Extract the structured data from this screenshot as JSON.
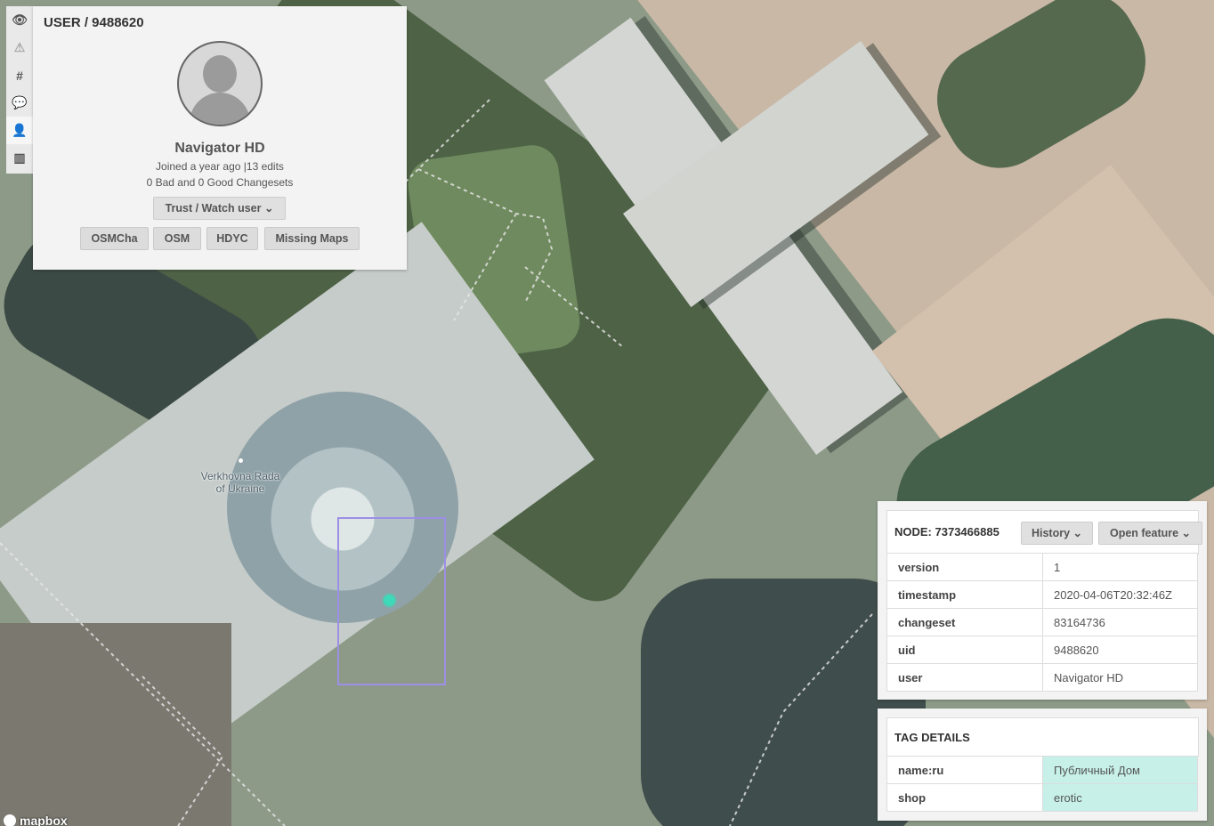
{
  "map": {
    "place_label_line1": "Verkhovna Rada",
    "place_label_line2": "of Ukraine",
    "attribution": "mapbox"
  },
  "rail": {
    "icons": [
      "eye-icon",
      "warning-icon",
      "hash-icon",
      "comment-icon",
      "user-icon",
      "map-icon"
    ],
    "glyphs": [
      "👁",
      "⚠",
      "#",
      "💬",
      "👤",
      "▥"
    ],
    "active": "user-icon"
  },
  "user_panel": {
    "title": "USER / 9488620",
    "name": "Navigator HD",
    "joined": "Joined a year ago  |13 edits",
    "changesets": "0 Bad and  0 Good Changesets",
    "trust_button": "Trust / Watch user ⌄",
    "links": [
      "OSMCha",
      "OSM",
      "HDYC",
      "Missing Maps"
    ]
  },
  "node_panel": {
    "title": "NODE: 7373466885",
    "history_button": "History ⌄",
    "open_feature_button": "Open feature ⌄",
    "rows": [
      {
        "key": "version",
        "value": "1"
      },
      {
        "key": "timestamp",
        "value": "2020-04-06T20:32:46Z"
      },
      {
        "key": "changeset",
        "value": "83164736"
      },
      {
        "key": "uid",
        "value": "9488620"
      },
      {
        "key": "user",
        "value": "Navigator HD"
      }
    ]
  },
  "tag_panel": {
    "title": "TAG DETAILS",
    "rows": [
      {
        "key": "name:ru",
        "value": "Публичный Дом"
      },
      {
        "key": "shop",
        "value": "erotic"
      }
    ],
    "highlight_color": "#c6f0e8"
  }
}
